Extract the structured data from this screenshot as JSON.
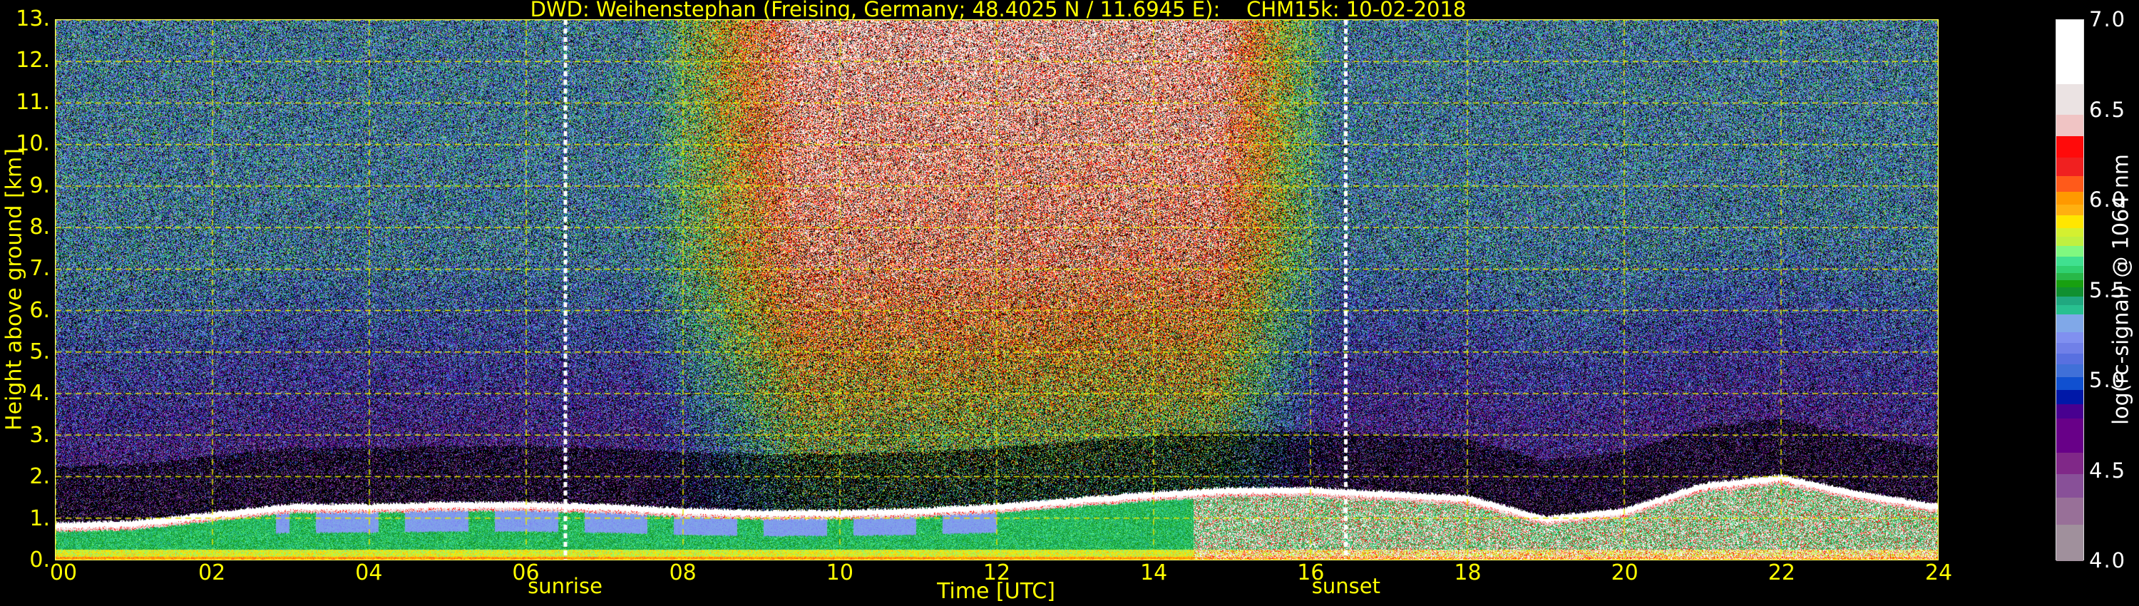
{
  "chart_data": {
    "type": "heatmap",
    "title": "DWD: Weihenstephan (Freising, Germany; 48.4025 N / 11.6945 E):    CHM15k: 10-02-2018",
    "xlabel": "Time [UTC]",
    "ylabel": "Height above ground [km]",
    "xlim": [
      0,
      24
    ],
    "ylim": [
      0,
      13
    ],
    "x_ticks": [
      0,
      2,
      4,
      6,
      8,
      10,
      12,
      14,
      16,
      18,
      20,
      22,
      24
    ],
    "x_tick_labels": [
      "00",
      "02",
      "04",
      "06",
      "08",
      "10",
      "12",
      "14",
      "16",
      "18",
      "20",
      "22",
      "24"
    ],
    "y_ticks": [
      0,
      1,
      2,
      3,
      4,
      5,
      6,
      7,
      8,
      9,
      10,
      11,
      12,
      13
    ],
    "y_tick_labels": [
      "0.",
      "1.",
      "2.",
      "3.",
      "4.",
      "5.",
      "6.",
      "7.",
      "8.",
      "9.",
      "10.",
      "11.",
      "12.",
      "13."
    ],
    "grid": true,
    "markers": [
      {
        "label": "sunrise",
        "time": 6.5
      },
      {
        "label": "sunset",
        "time": 16.45
      }
    ],
    "aerosol_layer_top_km": {
      "time": [
        0,
        1,
        2,
        3,
        4,
        5,
        6,
        7,
        8,
        9,
        10,
        11,
        12,
        13,
        14,
        15,
        16,
        17,
        18,
        19,
        20,
        21,
        22,
        23,
        24
      ],
      "height": [
        0.75,
        0.8,
        1.0,
        1.2,
        1.2,
        1.25,
        1.25,
        1.2,
        1.1,
        1.05,
        1.05,
        1.1,
        1.2,
        1.35,
        1.5,
        1.6,
        1.6,
        1.5,
        1.4,
        0.9,
        1.1,
        1.7,
        1.9,
        1.5,
        1.2
      ]
    },
    "colorbar": {
      "label": "log(rc-signal) @ 1064 nm",
      "range": [
        4.0,
        7.0
      ],
      "ticks": [
        4.0,
        4.5,
        5.0,
        5.5,
        6.0,
        6.5,
        7.0
      ],
      "tick_labels": [
        "4.0",
        "4.5",
        "5.0",
        "5.5",
        "6.0",
        "6.5",
        "7.0"
      ],
      "bounds": [
        4.0,
        4.2,
        4.35,
        4.48,
        4.6,
        4.79,
        4.87,
        4.95,
        5.02,
        5.09,
        5.15,
        5.21,
        5.27,
        5.37,
        5.42,
        5.47,
        5.52,
        5.56,
        5.6,
        5.64,
        5.69,
        5.75,
        5.8,
        5.85,
        5.92,
        5.98,
        6.05,
        6.14,
        6.24,
        6.36,
        6.48,
        6.65,
        7.0
      ],
      "colors": [
        "#a0909c",
        "#987098",
        "#885098",
        "#802888",
        "#680088",
        "#480090",
        "#0018a8",
        "#1050d0",
        "#4070d8",
        "#5870e0",
        "#7080e8",
        "#8090f0",
        "#80a8e8",
        "#28c090",
        "#20a880",
        "#109030",
        "#18a010",
        "#28b848",
        "#30d070",
        "#40e090",
        "#80f880",
        "#bff040",
        "#d4f030",
        "#ffe600",
        "#ffb010",
        "#ff9900",
        "#ff5a1a",
        "#f02020",
        "#ff0a0a",
        "#f0c4c4",
        "#ebe3e3",
        "#ffffff"
      ]
    }
  }
}
